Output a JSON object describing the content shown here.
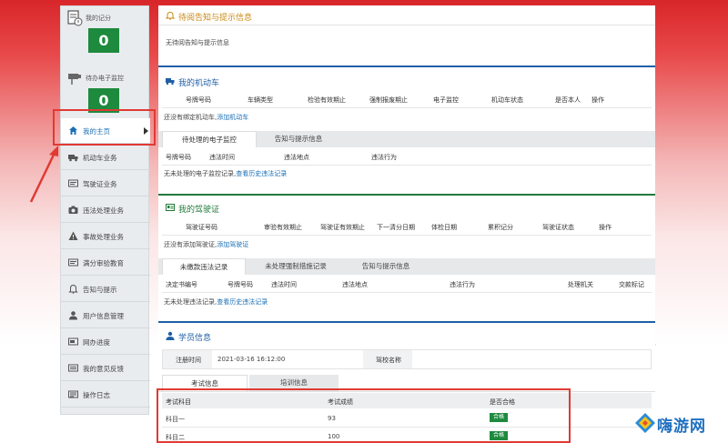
{
  "sidebar": {
    "score": {
      "label": "我的记分",
      "value": "0"
    },
    "pending_monitor": {
      "label": "待办电子监控",
      "value": "0"
    },
    "items": [
      {
        "label": "我的主页",
        "icon": "home-icon"
      },
      {
        "label": "机动车业务",
        "icon": "truck-icon"
      },
      {
        "label": "驾驶证业务",
        "icon": "card-icon"
      },
      {
        "label": "违法处理业务",
        "icon": "camera-icon"
      },
      {
        "label": "事故处理业务",
        "icon": "warning-icon"
      },
      {
        "label": "满分审验教育",
        "icon": "card-icon"
      },
      {
        "label": "告知与提示",
        "icon": "bell-icon"
      },
      {
        "label": "用户信息管理",
        "icon": "user-icon"
      },
      {
        "label": "网办进度",
        "icon": "progress-icon"
      },
      {
        "label": "我的意见反馈",
        "icon": "feedback-icon"
      },
      {
        "label": "操作日志",
        "icon": "log-icon"
      }
    ]
  },
  "notice": {
    "title": "待阅告知与提示信息",
    "empty": "无待阅告知与提示信息"
  },
  "vehicle": {
    "title": "我的机动车",
    "columns": [
      "号牌号码",
      "车辆类型",
      "检验有效期止",
      "强制报废期止",
      "电子监控",
      "机动车状态",
      "是否本人",
      "操作"
    ],
    "empty": "还没有绑定机动车,",
    "add_link": "添加机动车",
    "tabs": [
      "待处理的电子监控",
      "告知与提示信息"
    ],
    "sub_columns": [
      "号牌号码",
      "违法时间",
      "违法地点",
      "违法行为"
    ],
    "sub_empty": "无未处理的电子监控记录,",
    "sub_link": "查看历史违法记录"
  },
  "license": {
    "title": "我的驾驶证",
    "columns": [
      "驾驶证号码",
      "审验有效期止",
      "驾驶证有效期止",
      "下一清分日期",
      "体检日期",
      "累积记分",
      "驾驶证状态",
      "操作"
    ],
    "empty": "还没有添加驾驶证,",
    "add_link": "添加驾驶证",
    "tabs": [
      "未缴款违法记录",
      "未处理强制措施记录",
      "告知与提示信息"
    ],
    "sub_columns": [
      "决定书编号",
      "号牌号码",
      "违法时间",
      "违法地点",
      "违法行为",
      "处理机关",
      "交款标记"
    ],
    "sub_empty": "无未处理违法记录,",
    "sub_link": "查看历史违法记录"
  },
  "student": {
    "title": "学员信息",
    "reg_time_label": "注册时间",
    "reg_time_value": "2021-03-16 16:12:00",
    "school_label": "驾校名称",
    "school_value": "",
    "tabs": [
      "考试信息",
      "培训信息"
    ],
    "exam_columns": [
      "考试科目",
      "考试成绩",
      "是否合格"
    ],
    "exams": [
      {
        "subject": "科目一",
        "score": "93",
        "result": "合格"
      },
      {
        "subject": "科目二",
        "score": "100",
        "result": "合格"
      }
    ]
  },
  "watermark": {
    "text": "嗨游网"
  },
  "colors": {
    "accent_green": "#1d8a3e",
    "accent_blue": "#1f5fa6",
    "warning_orange": "#c98a14",
    "highlight_red": "#e03a33"
  }
}
